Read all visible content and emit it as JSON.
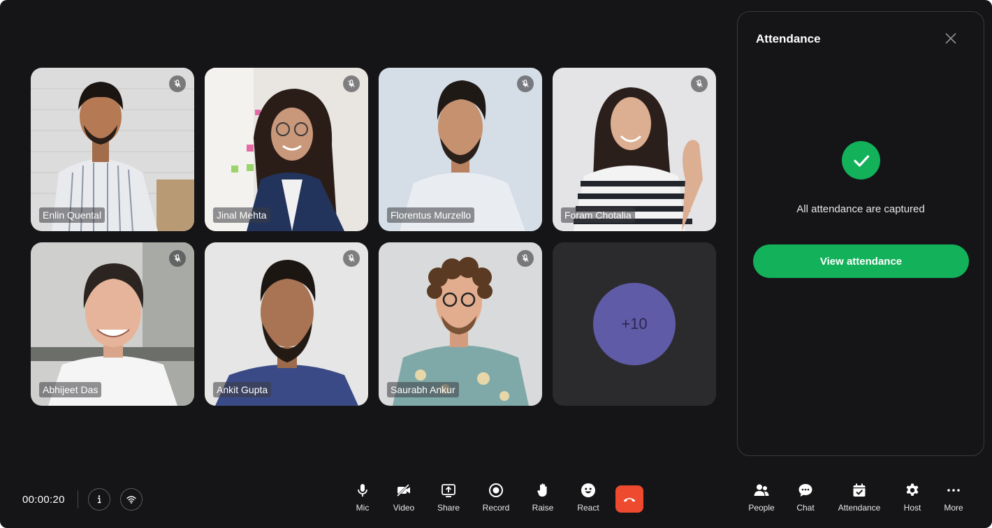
{
  "participants": [
    {
      "name": "Enlin Quental",
      "muted": true
    },
    {
      "name": "Jinal Mehta",
      "muted": true
    },
    {
      "name": "Florentus Murzello",
      "muted": true
    },
    {
      "name": "Foram Chotalia",
      "muted": true
    },
    {
      "name": "Abhijeet Das",
      "muted": true
    },
    {
      "name": "Ankit Gupta",
      "muted": true
    },
    {
      "name": "Saurabh Ankur",
      "muted": true
    }
  ],
  "overflow": {
    "label": "+10",
    "color": "#5f5ba7"
  },
  "panel": {
    "title": "Attendance",
    "message": "All attendance are captured",
    "button_label": "View attendance",
    "accent": "#12b15a",
    "icons": {
      "close": "close-icon",
      "status": "check-icon"
    }
  },
  "call": {
    "timer": "00:00:20",
    "info_icon": "info-icon",
    "network_icon": "wifi-icon"
  },
  "controls": [
    {
      "label": "Mic",
      "icon": "mic-icon"
    },
    {
      "label": "Video",
      "icon": "video-off-icon"
    },
    {
      "label": "Share",
      "icon": "share-screen-icon"
    },
    {
      "label": "Record",
      "icon": "record-icon"
    },
    {
      "label": "Raise",
      "icon": "raise-hand-icon"
    },
    {
      "label": "React",
      "icon": "smiley-icon"
    }
  ],
  "end_call": {
    "icon": "hang-up-icon",
    "color": "#ee4a2f"
  },
  "side_controls": [
    {
      "label": "People",
      "icon": "people-icon"
    },
    {
      "label": "Chat",
      "icon": "chat-icon"
    },
    {
      "label": "Attendance",
      "icon": "calendar-check-icon"
    },
    {
      "label": "Host",
      "icon": "gear-icon"
    },
    {
      "label": "More",
      "icon": "more-dots-icon"
    }
  ]
}
